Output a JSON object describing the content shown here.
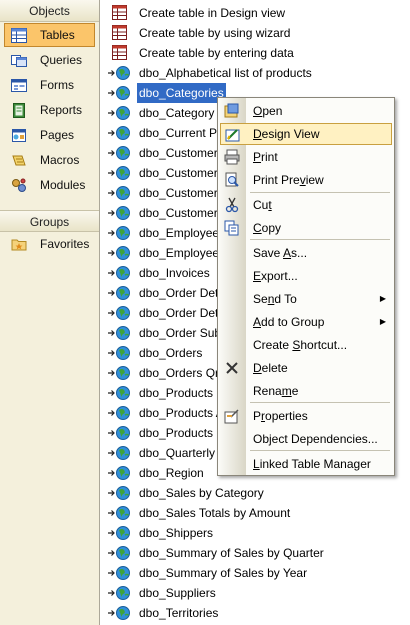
{
  "objects_bar": {
    "header": "Objects",
    "items": [
      {
        "label": "Tables",
        "icon": "tables-icon",
        "selected": true
      },
      {
        "label": "Queries",
        "icon": "queries-icon"
      },
      {
        "label": "Forms",
        "icon": "forms-icon"
      },
      {
        "label": "Reports",
        "icon": "reports-icon"
      },
      {
        "label": "Pages",
        "icon": "pages-icon"
      },
      {
        "label": "Macros",
        "icon": "macros-icon"
      },
      {
        "label": "Modules",
        "icon": "modules-icon"
      }
    ],
    "groups_header": "Groups",
    "groups": [
      {
        "label": "Favorites",
        "icon": "favorites-folder-icon"
      }
    ]
  },
  "table_list": {
    "shortcuts": [
      "Create table in Design view",
      "Create table by using wizard",
      "Create table by entering data"
    ],
    "tables": [
      "dbo_Alphabetical list of products",
      "dbo_Categories",
      "dbo_Category",
      "dbo_Current Pr",
      "dbo_Customer",
      "dbo_Customer",
      "dbo_Customer",
      "dbo_Customer",
      "dbo_Employee",
      "dbo_Employee",
      "dbo_Invoices",
      "dbo_Order Det",
      "dbo_Order Det",
      "dbo_Order Sub",
      "dbo_Orders",
      "dbo_Orders Qr",
      "dbo_Products",
      "dbo_Products A",
      "dbo_Products I",
      "dbo_Quarterly",
      "dbo_Region",
      "dbo_Sales by Category",
      "dbo_Sales Totals by Amount",
      "dbo_Shippers",
      "dbo_Summary of Sales by Quarter",
      "dbo_Summary of Sales by Year",
      "dbo_Suppliers",
      "dbo_Territories"
    ],
    "selected_table": "dbo_Categories"
  },
  "context_menu": {
    "items": [
      {
        "pre": "",
        "key": "O",
        "post": "pen",
        "icon": "open-icon"
      },
      {
        "pre": "",
        "key": "D",
        "post": "esign View",
        "icon": "design-view-icon",
        "highlighted": true
      },
      {
        "pre": "",
        "key": "P",
        "post": "rint",
        "icon": "print-icon"
      },
      {
        "pre": "Print Pre",
        "key": "v",
        "post": "iew",
        "icon": "print-preview-icon"
      },
      {
        "pre": "Cu",
        "key": "t",
        "post": "",
        "icon": "cut-icon"
      },
      {
        "pre": "",
        "key": "C",
        "post": "opy",
        "icon": "copy-icon"
      },
      {
        "pre": "Save ",
        "key": "A",
        "post": "s..."
      },
      {
        "pre": "",
        "key": "E",
        "post": "xport..."
      },
      {
        "pre": "Se",
        "key": "n",
        "post": "d To",
        "submenu": true
      },
      {
        "pre": "",
        "key": "A",
        "post": "dd to Group",
        "submenu": true
      },
      {
        "pre": "Create ",
        "key": "S",
        "post": "hortcut..."
      },
      {
        "pre": "",
        "key": "D",
        "post": "elete",
        "icon": "delete-icon"
      },
      {
        "pre": "Rena",
        "key": "m",
        "post": "e"
      },
      {
        "pre": "P",
        "key": "r",
        "post": "operties",
        "icon": "properties-icon"
      },
      {
        "pre": "Object Dependencies",
        "key": "",
        "post": "..."
      },
      {
        "pre": "",
        "key": "L",
        "post": "inked Table Manager"
      }
    ]
  },
  "colors": {
    "selection_blue": "#316ac5",
    "objects_bar_bg": "#f4f0dc",
    "selected_object_bg": "#fbc56a",
    "menu_highlight_bg": "#fff1c2"
  }
}
